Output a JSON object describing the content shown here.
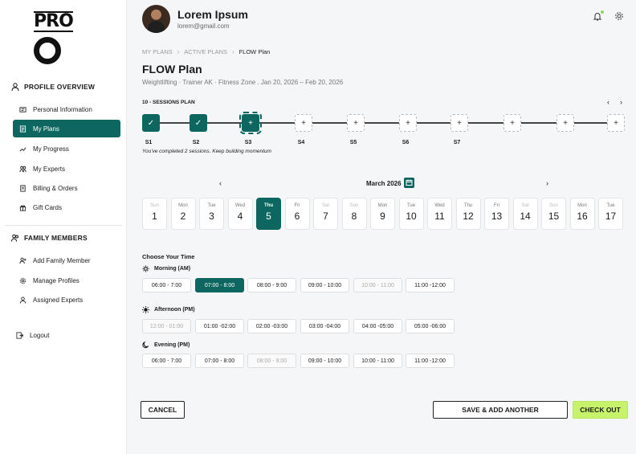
{
  "brand": {
    "logo_text": "PRO"
  },
  "sidebar": {
    "profile_heading": "PROFILE OVERVIEW",
    "profile_items": [
      {
        "label": "Personal Information",
        "icon": "id-card-icon"
      },
      {
        "label": "My Plans",
        "icon": "plan-list-icon"
      },
      {
        "label": "My Progress",
        "icon": "trend-icon"
      },
      {
        "label": "My Experts",
        "icon": "people-icon"
      },
      {
        "label": "Billing & Orders",
        "icon": "receipt-icon"
      },
      {
        "label": "Gift Cards",
        "icon": "gift-icon"
      }
    ],
    "family_heading": "FAMILY MEMBERS",
    "family_items": [
      {
        "label": "Add Family Member",
        "icon": "user-add-icon"
      },
      {
        "label": "Manage Profiles",
        "icon": "gear-icon"
      },
      {
        "label": "Assigned Experts",
        "icon": "user-icon"
      }
    ],
    "logout_label": "Logout"
  },
  "header": {
    "user_name": "Lorem Ipsum",
    "user_email": "lorem@gmail.com"
  },
  "breadcrumb": [
    "MY PLANS",
    "ACTIVE PLANS",
    "FLOW Plan"
  ],
  "plan": {
    "title": "FLOW Plan",
    "meta": "Weightlifting · Trainer AK · Fitness Zone . Jan 20, 2026 – Feb 20, 2026",
    "sessions_label": "10 - SESSIONS PLAN",
    "sessions_note": "You've completed 2 sessions. Keep building momentum",
    "steps": [
      {
        "state": "done",
        "label": "S1"
      },
      {
        "state": "done",
        "label": "S2"
      },
      {
        "state": "current",
        "label": "S3"
      },
      {
        "state": "empty",
        "label": "S4"
      },
      {
        "state": "empty",
        "label": "S5"
      },
      {
        "state": "empty",
        "label": "S6"
      },
      {
        "state": "empty",
        "label": "S7"
      },
      {
        "state": "empty",
        "label": ""
      },
      {
        "state": "empty",
        "label": ""
      },
      {
        "state": "empty",
        "label": ""
      }
    ]
  },
  "calendar": {
    "month": "March 2026",
    "days": [
      {
        "name": "Sun",
        "date": "1",
        "state": "dim"
      },
      {
        "name": "Mon",
        "date": "2",
        "state": ""
      },
      {
        "name": "Tue",
        "date": "3",
        "state": ""
      },
      {
        "name": "Wed",
        "date": "4",
        "state": ""
      },
      {
        "name": "Thu",
        "date": "5",
        "state": "sel"
      },
      {
        "name": "Fri",
        "date": "6",
        "state": ""
      },
      {
        "name": "Sat",
        "date": "7",
        "state": "dim"
      },
      {
        "name": "Sun",
        "date": "8",
        "state": "dim"
      },
      {
        "name": "Mon",
        "date": "9",
        "state": ""
      },
      {
        "name": "Tue",
        "date": "10",
        "state": ""
      },
      {
        "name": "Wed",
        "date": "11",
        "state": ""
      },
      {
        "name": "Thu",
        "date": "12",
        "state": ""
      },
      {
        "name": "Fri",
        "date": "13",
        "state": ""
      },
      {
        "name": "Sat",
        "date": "14",
        "state": "dim"
      },
      {
        "name": "Sun",
        "date": "15",
        "state": "dim"
      },
      {
        "name": "Mon",
        "date": "16",
        "state": ""
      },
      {
        "name": "Tue",
        "date": "17",
        "state": ""
      }
    ]
  },
  "times": {
    "heading": "Choose Your Time",
    "periods": [
      {
        "label": "Morning (AM)",
        "icon": "sun-small-icon",
        "slots": [
          {
            "t": "06:00 - 7:00",
            "s": ""
          },
          {
            "t": "07:00 - 8:00",
            "s": "sel"
          },
          {
            "t": "08:00 - 9:00",
            "s": ""
          },
          {
            "t": "09:00 - 10:00",
            "s": ""
          },
          {
            "t": "10:00 - 11:00",
            "s": "dis"
          },
          {
            "t": "11:00 -12:00",
            "s": ""
          }
        ]
      },
      {
        "label": "Afternoon (PM)",
        "icon": "sun-icon",
        "slots": [
          {
            "t": "12:00 - 01:00",
            "s": "dis"
          },
          {
            "t": "01:00 -02:00",
            "s": ""
          },
          {
            "t": "02:00 -03:00",
            "s": ""
          },
          {
            "t": "03:00 -04:00",
            "s": ""
          },
          {
            "t": "04:00 -05:00",
            "s": ""
          },
          {
            "t": "05:00 -06:00",
            "s": ""
          }
        ]
      },
      {
        "label": "Evening (PM)",
        "icon": "moon-icon",
        "slots": [
          {
            "t": "06:00 - 7:00",
            "s": ""
          },
          {
            "t": "07:00 - 8:00",
            "s": ""
          },
          {
            "t": "08:00 - 9:00",
            "s": "dis"
          },
          {
            "t": "09:00 - 10:00",
            "s": ""
          },
          {
            "t": "10:00 - 11:00",
            "s": ""
          },
          {
            "t": "11:00 -12:00",
            "s": ""
          }
        ]
      }
    ]
  },
  "actions": {
    "cancel": "CANCEL",
    "save_add": "SAVE & ADD ANOTHER",
    "checkout": "CHECK OUT"
  },
  "colors": {
    "primary": "#0e6660",
    "accent": "#c7f36a"
  }
}
